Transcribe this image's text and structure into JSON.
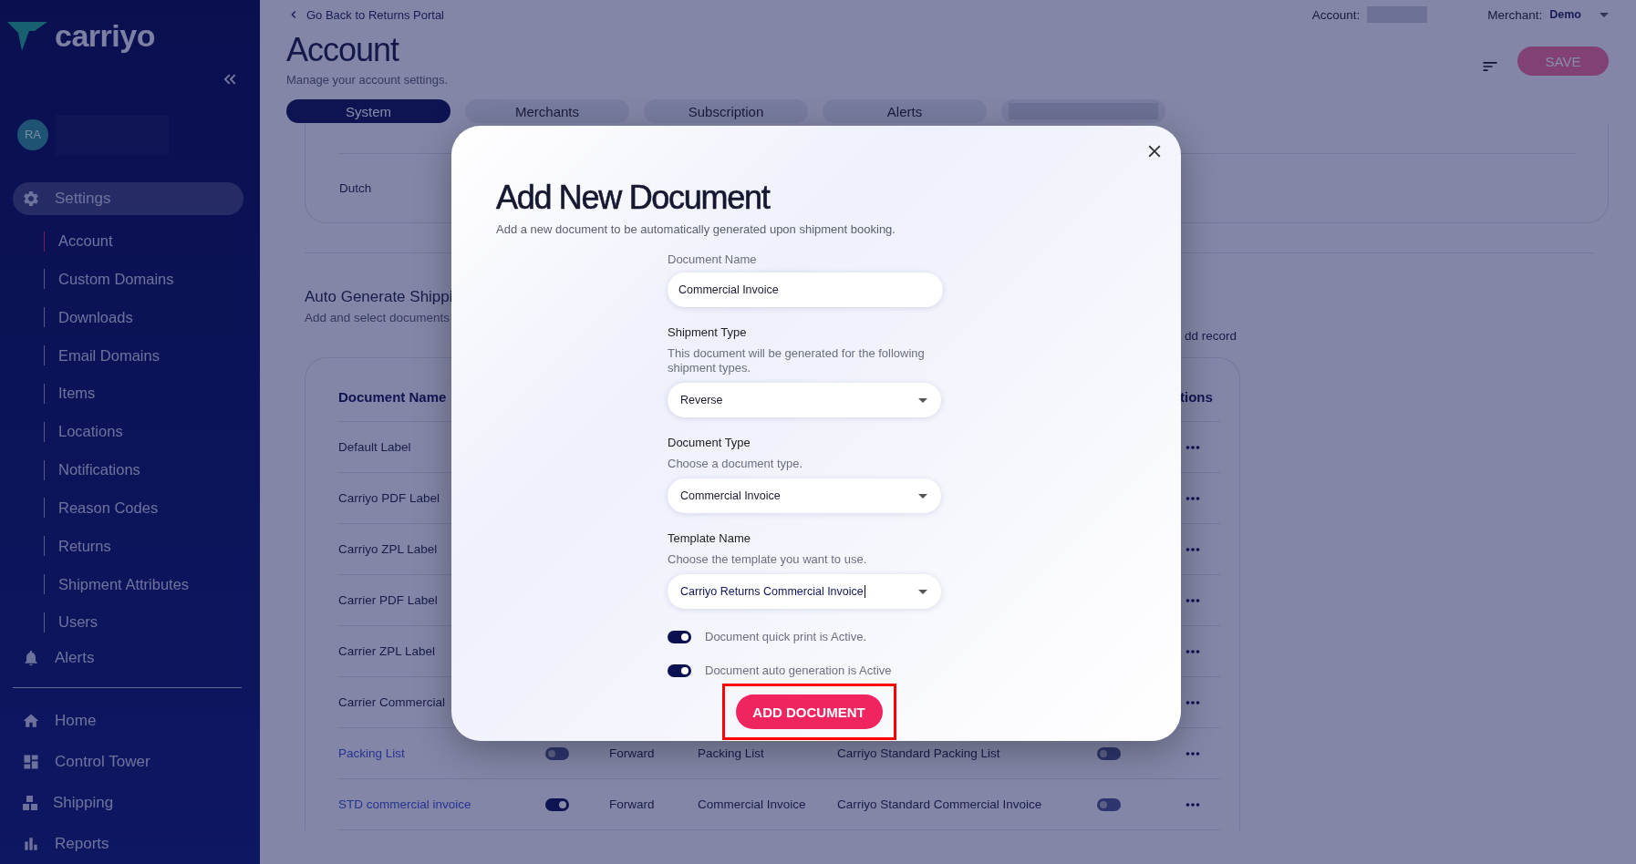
{
  "sidebar": {
    "logo": "carriyo",
    "user": {
      "initials": "RA"
    },
    "nav": [
      {
        "label": "Settings",
        "selected": true,
        "expanded": true,
        "children": [
          {
            "label": "Account",
            "selected": true
          },
          {
            "label": "Custom Domains",
            "selected": false
          },
          {
            "label": "Downloads",
            "selected": false
          },
          {
            "label": "Email Domains",
            "selected": false
          },
          {
            "label": "Items",
            "selected": false
          },
          {
            "label": "Locations",
            "selected": false
          },
          {
            "label": "Notifications",
            "selected": false
          },
          {
            "label": "Reason Codes",
            "selected": false
          },
          {
            "label": "Returns",
            "selected": false
          },
          {
            "label": "Shipment Attributes",
            "selected": false
          },
          {
            "label": "Users",
            "selected": false
          }
        ]
      },
      {
        "label": "Alerts",
        "selected": false,
        "expanded": false
      }
    ],
    "nav_bottom": [
      {
        "label": "Home"
      },
      {
        "label": "Control Tower"
      },
      {
        "label": "Shipping"
      },
      {
        "label": "Reports"
      }
    ]
  },
  "header": {
    "back_link": "Go Back to Returns Portal",
    "title": "Account",
    "subtitle": "Manage your account settings.",
    "account_label": "Account:",
    "merchant_label": "Merchant:",
    "merchant_value": "Demo",
    "save_button": "SAVE",
    "tabs": [
      {
        "label": "System",
        "selected": true,
        "kind": "text"
      },
      {
        "label": "Merchants",
        "selected": false,
        "kind": "text"
      },
      {
        "label": "Subscription",
        "selected": false,
        "kind": "text"
      },
      {
        "label": "Alerts",
        "selected": false,
        "kind": "text"
      },
      {
        "selected": false,
        "kind": "redacted"
      }
    ]
  },
  "languages": [
    "Dutch"
  ],
  "section": {
    "title": "Auto Generate Shippi",
    "subtitle": "Add and select documents",
    "add_record": "dd record"
  },
  "table": {
    "columns": [
      "Document Name",
      "tions"
    ],
    "rows": [
      {
        "name": "Default Label",
        "link": false
      },
      {
        "name": "Carriyo PDF Label",
        "link": false
      },
      {
        "name": "Carriyo ZPL Label",
        "link": false
      },
      {
        "name": "Carrier PDF Label",
        "link": false
      },
      {
        "name": "Carrier ZPL Label",
        "link": false
      },
      {
        "name": "Carrier Commercial",
        "link": false
      },
      {
        "name": "Packing List",
        "link": true,
        "quick_print": false,
        "shipment_type": "Forward",
        "document_type": "Packing List",
        "template": "Carriyo Standard Packing List",
        "auto_generate": false
      },
      {
        "name": "STD commercial invoice",
        "link": true,
        "quick_print": true,
        "shipment_type": "Forward",
        "document_type": "Commercial Invoice",
        "template": "Carriyo Standard Commercial Invoice",
        "auto_generate": false
      }
    ]
  },
  "modal": {
    "title": "Add New Document",
    "subtitle": "Add a new document to be automatically generated upon shipment booking.",
    "fields": [
      {
        "kind": "text",
        "label": "Document Name",
        "value": "Commercial Invoice",
        "focused": false
      },
      {
        "kind": "select",
        "label": "Shipment Type",
        "help": "This document will be generated for the following shipment types.",
        "value": "Reverse",
        "focused": false
      },
      {
        "kind": "select",
        "label": "Document Type",
        "help": "Choose a document type.",
        "value": "Commercial Invoice",
        "focused": false
      },
      {
        "kind": "select",
        "label": "Template Name",
        "help": "Choose the template you want to use.",
        "value": "Carriyo Returns Commercial Invoice",
        "focused": true
      }
    ],
    "toggles": [
      {
        "label": "Document quick print is Active.",
        "on": true
      },
      {
        "label": "Document auto generation is Active",
        "on": true
      }
    ],
    "submit_button": "ADD DOCUMENT",
    "submit_highlighted": true
  }
}
